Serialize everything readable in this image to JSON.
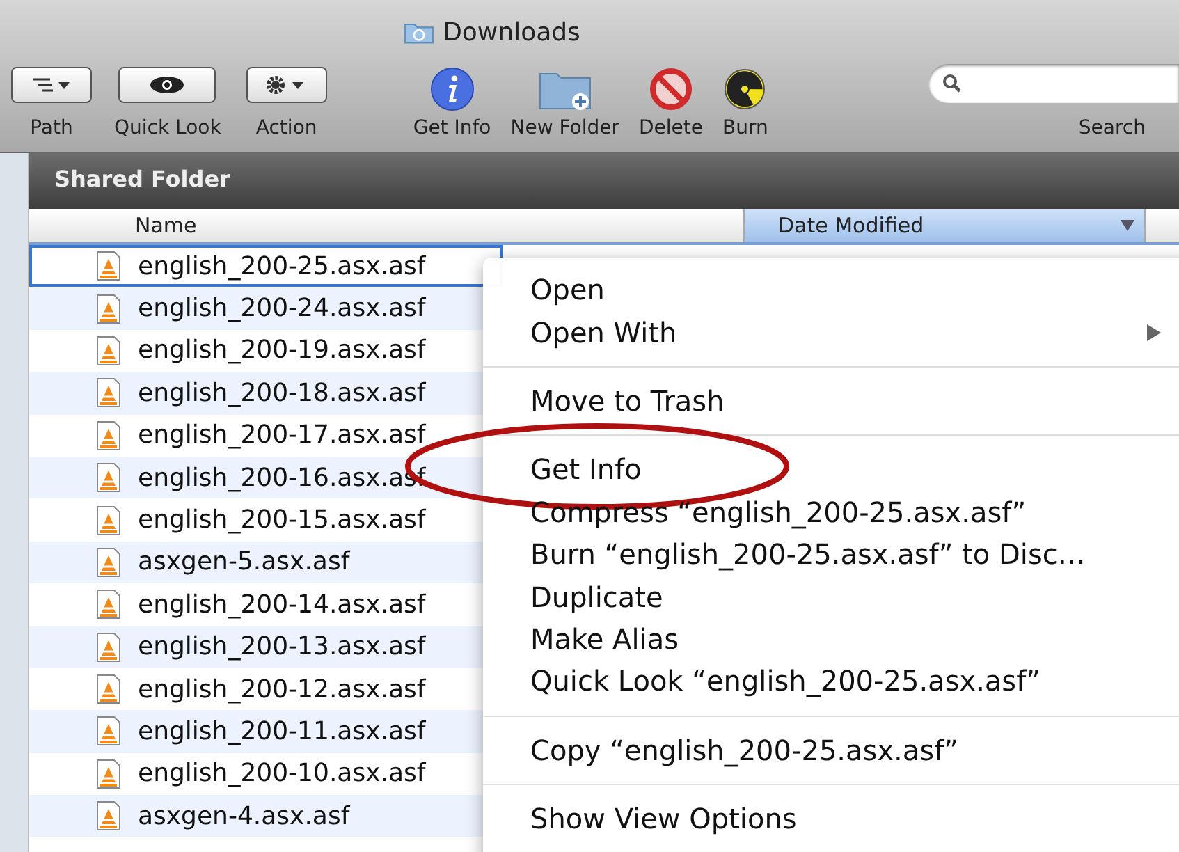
{
  "window": {
    "title": "Downloads"
  },
  "toolbar": [
    {
      "kind": "path",
      "label": "Path"
    },
    {
      "kind": "quicklook",
      "label": "Quick Look"
    },
    {
      "kind": "action",
      "label": "Action"
    },
    {
      "kind": "info",
      "label": "Get Info"
    },
    {
      "kind": "newfolder",
      "label": "New Folder"
    },
    {
      "kind": "delete",
      "label": "Delete"
    },
    {
      "kind": "burn",
      "label": "Burn"
    }
  ],
  "search": {
    "label": "Search"
  },
  "section_title": "Shared Folder",
  "table": {
    "columns": [
      {
        "label": "Name",
        "selected": false
      },
      {
        "label": "Date Modified",
        "selected": true
      }
    ],
    "rows": [
      {
        "name": "english_200-25.asx.asf",
        "selected": true
      },
      {
        "name": "english_200-24.asx.asf",
        "selected": false
      },
      {
        "name": "english_200-19.asx.asf",
        "selected": false
      },
      {
        "name": "english_200-18.asx.asf",
        "selected": false
      },
      {
        "name": "english_200-17.asx.asf",
        "selected": false
      },
      {
        "name": "english_200-16.asx.asf",
        "selected": false
      },
      {
        "name": "english_200-15.asx.asf",
        "selected": false
      },
      {
        "name": "asxgen-5.asx.asf",
        "selected": false
      },
      {
        "name": "english_200-14.asx.asf",
        "selected": false
      },
      {
        "name": "english_200-13.asx.asf",
        "selected": false
      },
      {
        "name": "english_200-12.asx.asf",
        "selected": false
      },
      {
        "name": "english_200-11.asx.asf",
        "selected": false
      },
      {
        "name": "english_200-10.asx.asf",
        "selected": false
      },
      {
        "name": "asxgen-4.asx.asf",
        "selected": false
      }
    ]
  },
  "context_menu": {
    "groups": [
      [
        {
          "kind": "plain",
          "label": "Open",
          "submenu": false
        },
        {
          "kind": "plain",
          "label": "Open With",
          "submenu": true
        }
      ],
      [
        {
          "kind": "plain",
          "label": "Move to Trash",
          "submenu": false
        }
      ],
      [
        {
          "kind": "circled",
          "label": "Get Info",
          "submenu": false
        },
        {
          "kind": "plain",
          "label": "Compress “english_200-25.asx.asf”",
          "submenu": false
        },
        {
          "kind": "plain",
          "label": "Burn “english_200-25.asx.asf” to Disc…",
          "submenu": false
        },
        {
          "kind": "plain",
          "label": "Duplicate",
          "submenu": false
        },
        {
          "kind": "plain",
          "label": "Make Alias",
          "submenu": false
        },
        {
          "kind": "plain",
          "label": "Quick Look “english_200-25.asx.asf”",
          "submenu": false
        }
      ],
      [
        {
          "kind": "plain",
          "label": "Copy “english_200-25.asx.asf”",
          "submenu": false
        }
      ],
      [
        {
          "kind": "plain",
          "label": "Show View Options",
          "submenu": false
        }
      ]
    ]
  }
}
